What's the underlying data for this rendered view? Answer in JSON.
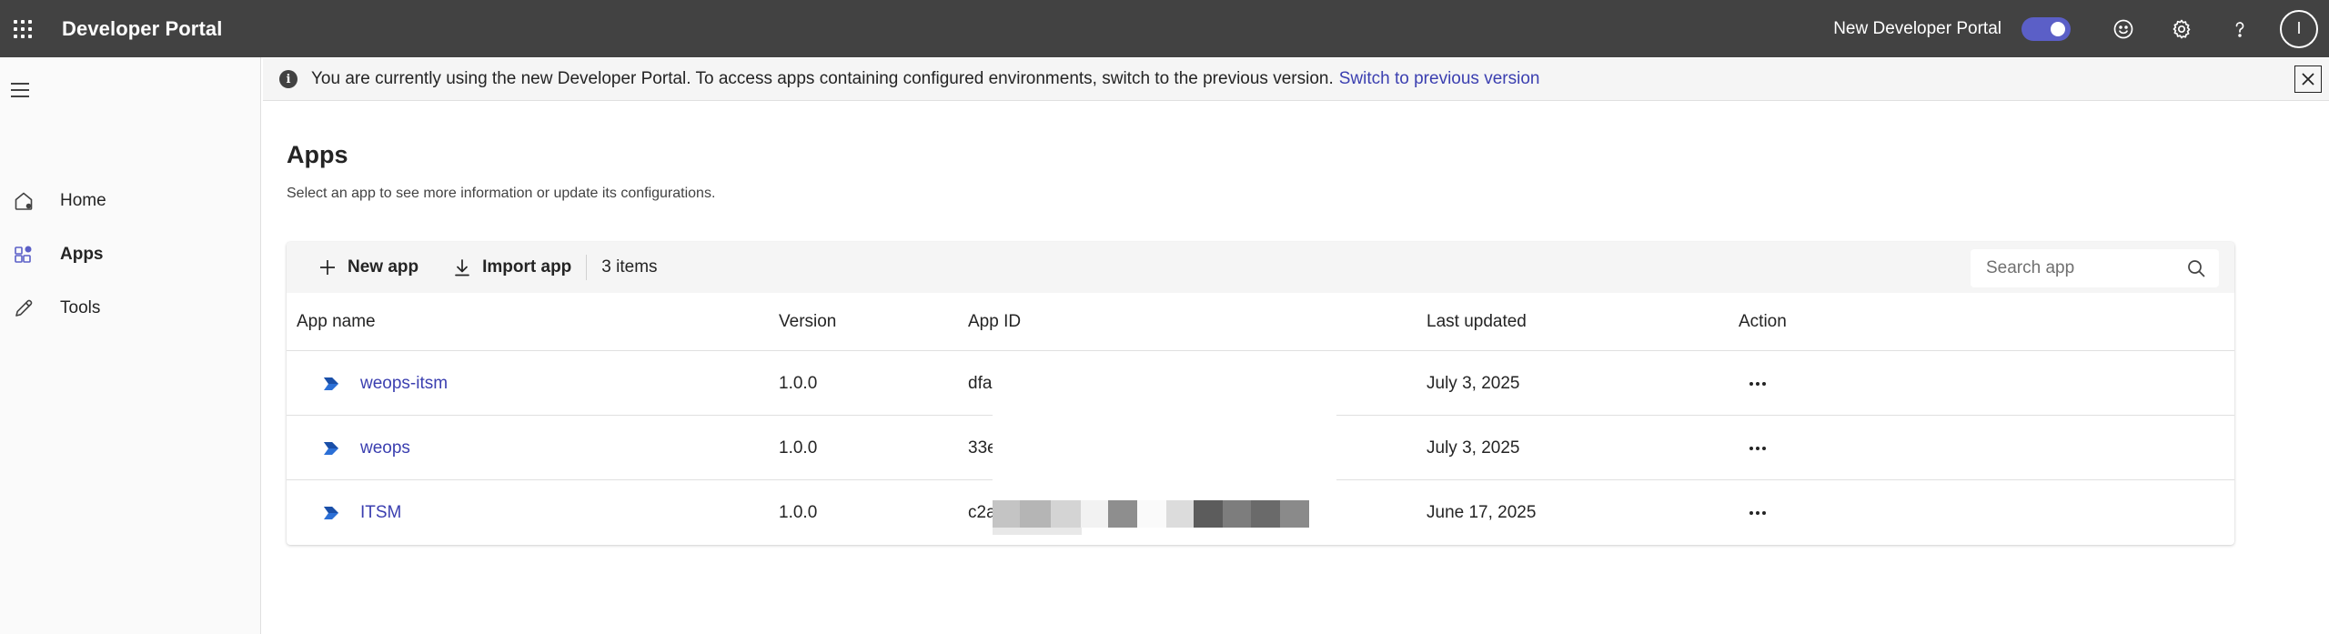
{
  "header": {
    "title": "Developer Portal",
    "toggle_label": "New Developer Portal",
    "toggle_on": true,
    "avatar_initial": "I"
  },
  "sidebar": {
    "items": [
      {
        "label": "Home",
        "icon": "home-icon"
      },
      {
        "label": "Apps",
        "icon": "apps-icon",
        "active": true
      },
      {
        "label": "Tools",
        "icon": "pencil-icon"
      }
    ]
  },
  "banner": {
    "message": "You are currently using the new Developer Portal. To access apps containing configured environments, switch to the previous version.",
    "link": "Switch to previous version"
  },
  "main": {
    "title": "Apps",
    "subtitle": "Select an app to see more information or update its configurations."
  },
  "toolbar": {
    "new_app": "New app",
    "import_app": "Import app",
    "items_count": "3 items",
    "search_placeholder": "Search app"
  },
  "table": {
    "columns": [
      "App name",
      "Version",
      "App ID",
      "Last updated",
      "Action"
    ],
    "rows": [
      {
        "name": "weops-itsm",
        "version": "1.0.0",
        "app_id": "dfa",
        "last_updated": "July 3, 2025"
      },
      {
        "name": "weops",
        "version": "1.0.0",
        "app_id": "33e",
        "last_updated": "July 3, 2025"
      },
      {
        "name": "ITSM",
        "version": "1.0.0",
        "app_id": "c2a",
        "last_updated": "June 17, 2025"
      }
    ]
  },
  "colors": {
    "topbar": "#424242",
    "accent": "#5b5fc7",
    "link": "#3b3fb0"
  }
}
